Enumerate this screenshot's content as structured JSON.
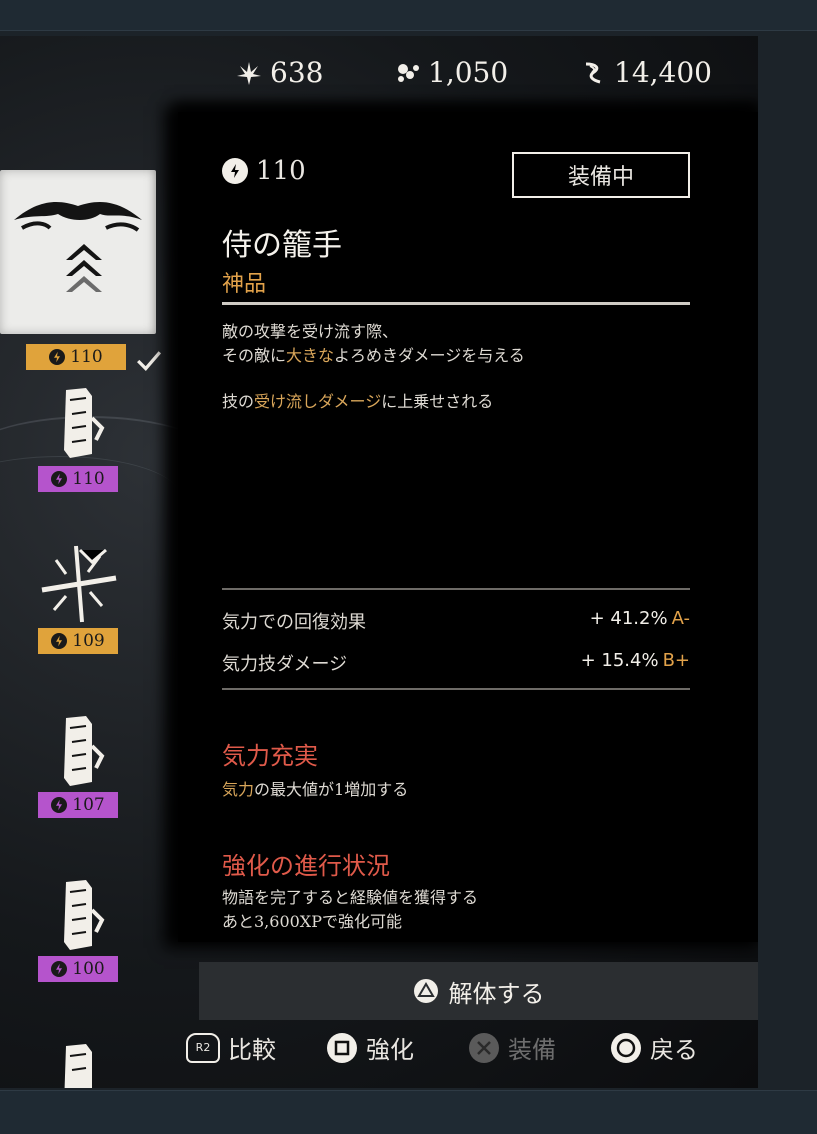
{
  "currencies": [
    {
      "icon": "supplies-icon",
      "value": "638"
    },
    {
      "icon": "flowers-icon",
      "value": "1,050"
    },
    {
      "icon": "wind-icon",
      "value": "14,400"
    }
  ],
  "item": {
    "power": "110",
    "equipped_label": "装備中",
    "name": "侍の籠手",
    "rarity": "神品",
    "rarity_color": "#e2a24a",
    "desc1_line1": "敵の攻撃を受け流す際、",
    "desc1_line2_a": "その敵に",
    "desc1_line2_hl": "大きな",
    "desc1_line2_b": "よろめきダメージを与える",
    "desc2_a": "技の",
    "desc2_hl1": "受け流し",
    "desc2_b": "ダメージ",
    "desc2_c": "に上乗せされる",
    "stats": [
      {
        "label": "気力での回復効果",
        "value": "+ 41.2%",
        "grade": "A-"
      },
      {
        "label": "気力技ダメージ",
        "value": "+ 15.4%",
        "grade": "B+"
      }
    ],
    "perk_title": "気力充実",
    "perk_desc_hl": "気力",
    "perk_desc_rest": "の最大値が1増加する",
    "progress_title": "強化の進行状況",
    "progress_line1": "物語を完了すると経験値を獲得する",
    "progress_line2": "あと3,600XPで強化可能"
  },
  "sidebar": [
    {
      "power": "110",
      "tier": "gold",
      "selected": true,
      "icon": "gauntlet-icon"
    },
    {
      "power": "110",
      "tier": "purple",
      "selected": false,
      "icon": "scroll-icon"
    },
    {
      "power": "109",
      "tier": "gold",
      "selected": false,
      "icon": "swords-icon"
    },
    {
      "power": "107",
      "tier": "purple",
      "selected": false,
      "icon": "scroll-icon"
    },
    {
      "power": "100",
      "tier": "purple",
      "selected": false,
      "icon": "scroll-icon"
    }
  ],
  "actions": {
    "dismantle": "解体する",
    "compare_key": "R2",
    "compare": "比較",
    "upgrade": "強化",
    "equip": "装備",
    "back": "戻る"
  },
  "colors": {
    "gold": "#e0a33b",
    "purple": "#b554cc",
    "accent_red": "#e05a4a"
  }
}
